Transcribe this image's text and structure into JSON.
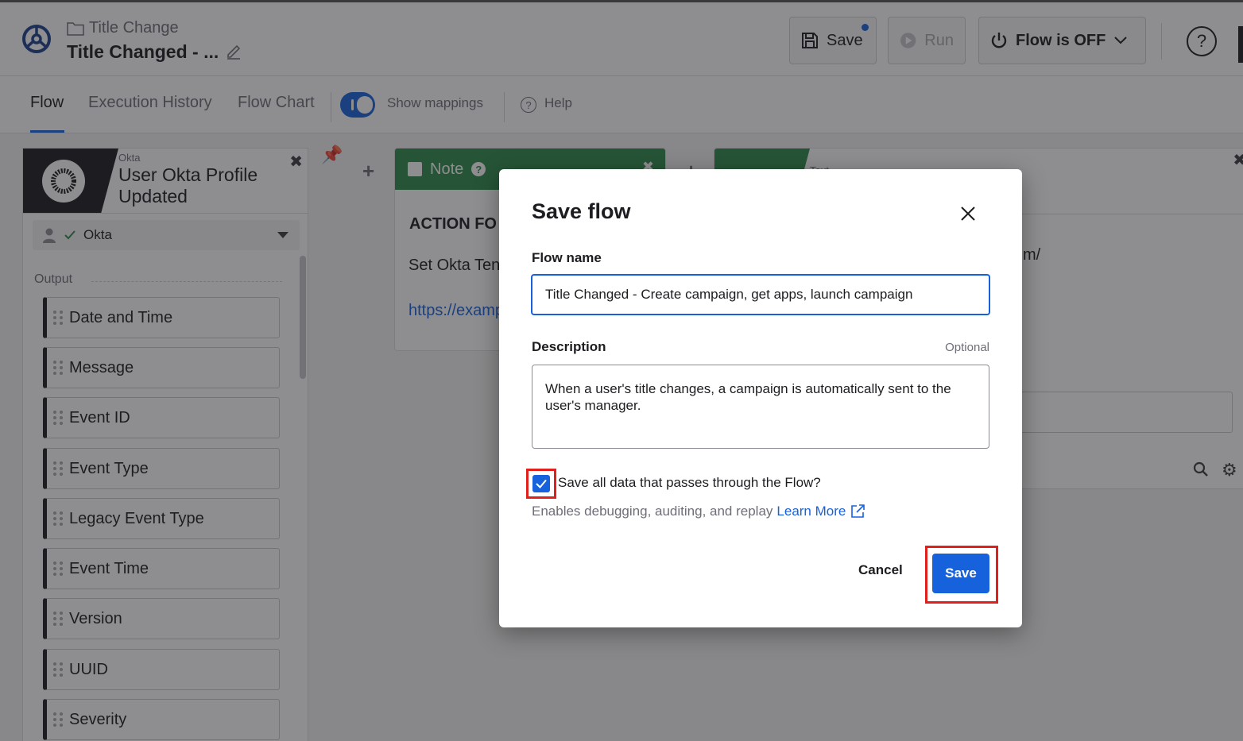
{
  "header": {
    "breadcrumb": "Title Change",
    "title": "Title Changed - ...",
    "save_label": "Save",
    "run_label": "Run",
    "flow_status": "Flow is OFF",
    "help_symbol": "?"
  },
  "tabs": {
    "flow": "Flow",
    "execution_history": "Execution History",
    "flow_chart": "Flow Chart",
    "show_mappings": "Show mappings",
    "help": "Help"
  },
  "event_card": {
    "app": "Okta",
    "title": "User Okta Profile Updated",
    "connection": "Okta",
    "output_label": "Output",
    "outputs": [
      "Date and Time",
      "Message",
      "Event ID",
      "Event Type",
      "Legacy Event Type",
      "Event Time",
      "Version",
      "UUID",
      "Severity"
    ]
  },
  "note_card": {
    "title": "Note",
    "heading": "ACTION FO",
    "body": "Set Okta Ten",
    "link": "https://examp"
  },
  "text_card": {
    "app": "Text",
    "value": "m/"
  },
  "modal": {
    "title": "Save flow",
    "name_label": "Flow name",
    "name_value": "Title Changed - Create campaign, get apps, launch campaign",
    "description_label": "Description",
    "optional": "Optional",
    "description_value": "When a user's title changes, a campaign is automatically sent to the user's manager.",
    "checkbox_checked": true,
    "checkbox_label": "Save all data that passes through the Flow?",
    "hint": "Enables debugging, auditing, and replay",
    "learn_more": "Learn More",
    "cancel_label": "Cancel",
    "save_label": "Save"
  },
  "colors": {
    "primary": "#1662dd",
    "highlight": "#e0201b",
    "note_green": "#2e8a4a"
  }
}
